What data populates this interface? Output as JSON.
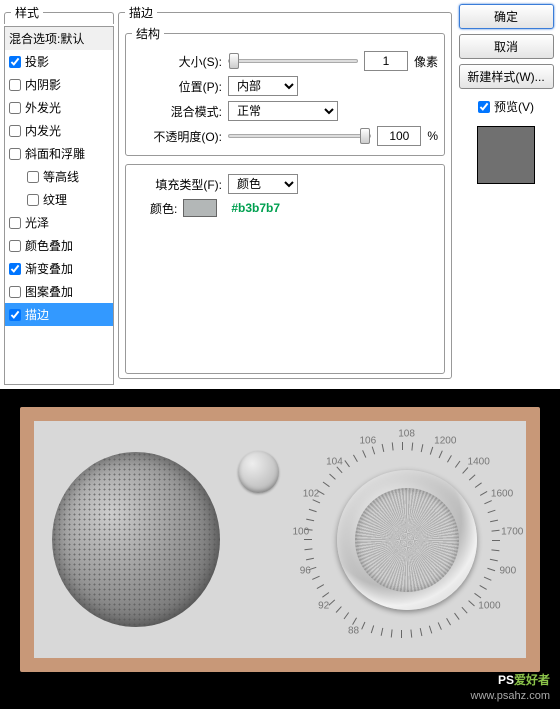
{
  "styles": {
    "legend": "样式",
    "header": "混合选项:默认",
    "items": [
      {
        "label": "投影",
        "checked": true,
        "indent": false
      },
      {
        "label": "内阴影",
        "checked": false,
        "indent": false
      },
      {
        "label": "外发光",
        "checked": false,
        "indent": false
      },
      {
        "label": "内发光",
        "checked": false,
        "indent": false
      },
      {
        "label": "斜面和浮雕",
        "checked": false,
        "indent": false
      },
      {
        "label": "等高线",
        "checked": false,
        "indent": true
      },
      {
        "label": "纹理",
        "checked": false,
        "indent": true
      },
      {
        "label": "光泽",
        "checked": false,
        "indent": false
      },
      {
        "label": "颜色叠加",
        "checked": false,
        "indent": false
      },
      {
        "label": "渐变叠加",
        "checked": true,
        "indent": false
      },
      {
        "label": "图案叠加",
        "checked": false,
        "indent": false
      },
      {
        "label": "描边",
        "checked": true,
        "indent": false,
        "selected": true
      }
    ]
  },
  "stroke": {
    "legend": "描边",
    "structure_legend": "结构",
    "size_label": "大小(S):",
    "size_value": "1",
    "size_unit": "像素",
    "position_label": "位置(P):",
    "position_value": "内部",
    "blend_label": "混合模式:",
    "blend_value": "正常",
    "opacity_label": "不透明度(O):",
    "opacity_value": "100",
    "opacity_unit": "%",
    "filltype_label": "填充类型(F):",
    "filltype_value": "颜色",
    "color_label": "颜色:",
    "color_swatch": "#b3b7b7",
    "color_hex": "#b3b7b7"
  },
  "buttons": {
    "ok": "确定",
    "cancel": "取消",
    "newstyle": "新建样式(W)...",
    "preview": "预览(V)"
  },
  "dial_labels": [
    "88",
    "92",
    "96",
    "100",
    "102",
    "104",
    "106",
    "108",
    "1200",
    "1400",
    "1600",
    "1700",
    "900",
    "1000"
  ],
  "watermark": {
    "line1a": "PS",
    "line1b": "爱好者",
    "line2": "www.psahz.com"
  }
}
